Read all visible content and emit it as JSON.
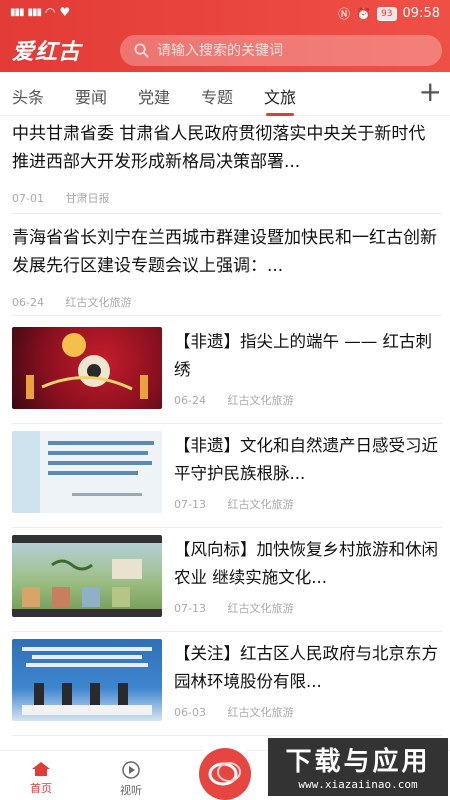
{
  "status": {
    "left_icons": "HD",
    "time": "09:58",
    "battery": "93"
  },
  "header": {
    "logo": "爱红古",
    "search_placeholder": "请输入搜索的关键词"
  },
  "tabs": [
    {
      "label": "头条"
    },
    {
      "label": "要闻"
    },
    {
      "label": "党建"
    },
    {
      "label": "专题"
    },
    {
      "label": "文旅",
      "active": true
    }
  ],
  "articles": [
    {
      "title": "中共甘肃省委 甘肃省人民政府贯彻落实中央关于新时代推进西部大开发形成新格局决策部署...",
      "date": "07-01",
      "source": "甘肃日报"
    },
    {
      "title": "青海省省长刘宁在兰西城市群建设暨加快民和一红古创新发展先行区建设专题会议上强调：...",
      "date": "06-24",
      "source": "红古文化旅游"
    }
  ],
  "thumb_articles": [
    {
      "title": "【非遗】指尖上的端午 —— 红古刺绣",
      "date": "06-24",
      "source": "红古文化旅游"
    },
    {
      "title": "【非遗】文化和自然遗产日感受习近平守护民族根脉...",
      "date": "07-13",
      "source": "红古文化旅游"
    },
    {
      "title": "【风向标】加快恢复乡村旅游和休闲农业 继续实施文化...",
      "date": "07-13",
      "source": "红古文化旅游"
    },
    {
      "title": "【关注】红古区人民政府与北京东方园林环境股份有限...",
      "date": "06-03",
      "source": "红古文化旅游"
    }
  ],
  "nav": {
    "home": "首页",
    "listen": "视听"
  },
  "watermark": {
    "line1": "下载与应用",
    "line2": "www.xiazaiinao.com"
  },
  "colors": {
    "accent": "#e33b36"
  }
}
